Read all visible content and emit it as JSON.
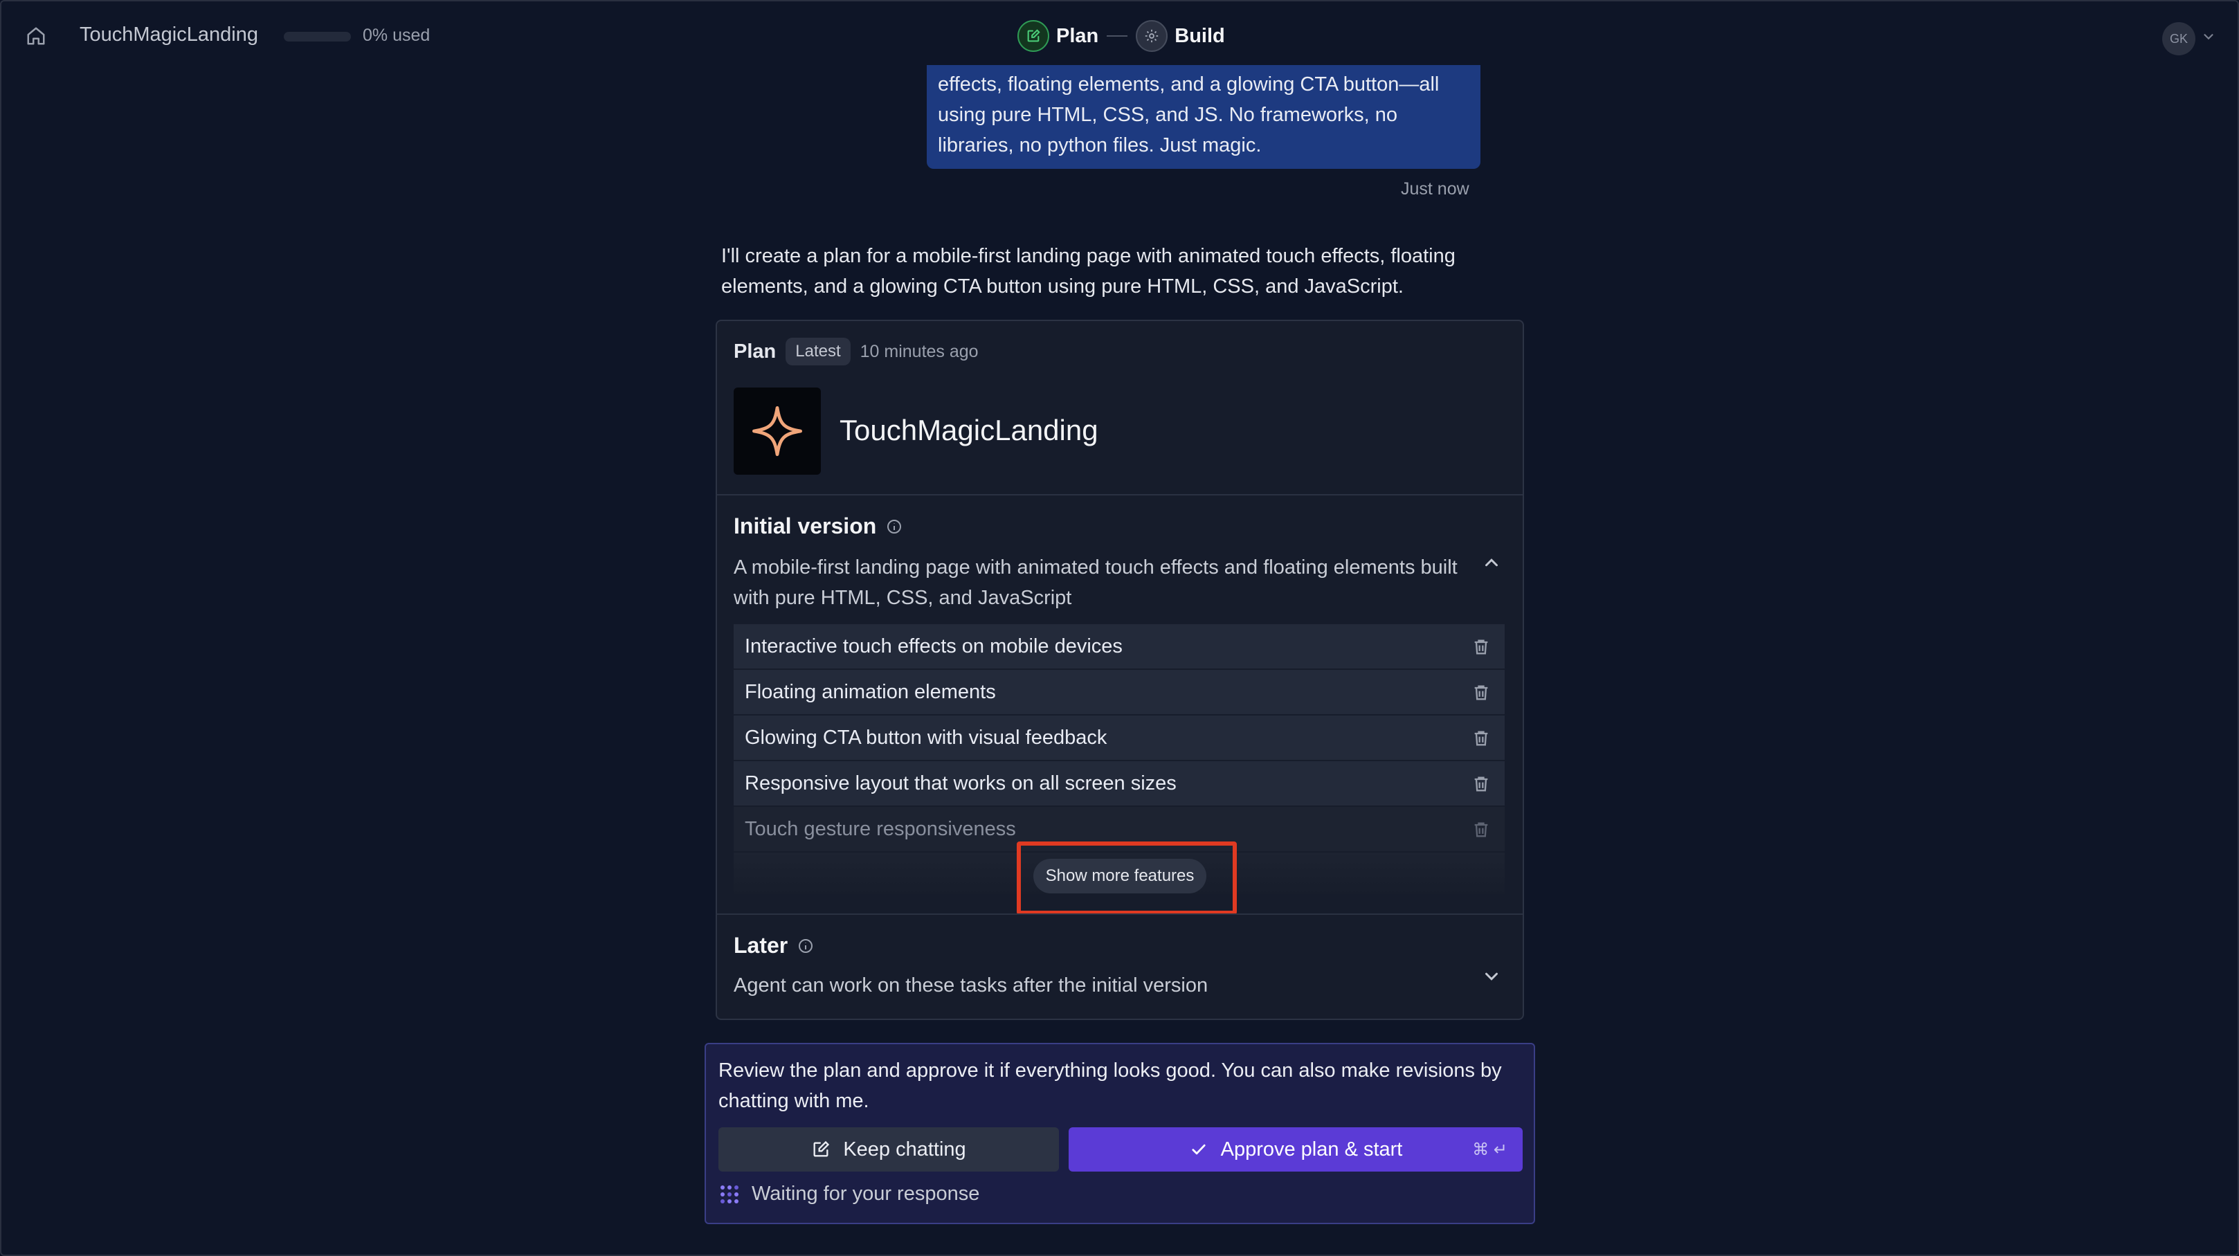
{
  "header": {
    "app_name": "TouchMagicLanding",
    "usage_text": "0% used",
    "usage_fraction": 0.0,
    "steps": [
      {
        "label": "Plan",
        "icon": "edit-icon"
      },
      {
        "label": "Build",
        "icon": "gear-icon"
      }
    ],
    "avatar_initials": "GK"
  },
  "chat": {
    "user_message": "effects, floating elements, and a glowing CTA button—all using pure HTML, CSS, and JS. No frameworks, no libraries, no python files. Just magic.",
    "timestamp": "Just now",
    "assistant_message": "I'll create a plan for a mobile-first landing page with animated touch effects, floating elements, and a glowing CTA button using pure HTML, CSS, and JavaScript."
  },
  "plan": {
    "label": "Plan",
    "badge": "Latest",
    "time": "10 minutes ago",
    "title": "TouchMagicLanding",
    "initial": {
      "title": "Initial version",
      "description": "A mobile-first landing page with animated touch effects and floating elements built with pure HTML, CSS, and JavaScript",
      "features": [
        "Interactive touch effects on mobile devices",
        "Floating animation elements",
        "Glowing CTA button with visual feedback",
        "Responsive layout that works on all screen sizes",
        "Touch gesture responsiveness"
      ],
      "show_more_label": "Show more features"
    },
    "later": {
      "title": "Later",
      "description": "Agent can work on these tasks after the initial version"
    }
  },
  "approval": {
    "text": "Review the plan and approve it if everything looks good. You can also make revisions by chatting with me.",
    "keep_label": "Keep chatting",
    "approve_label": "Approve plan & start",
    "shortcut": "⌘ ↵",
    "waiting_text": "Waiting for your response"
  },
  "colors": {
    "background": "#0e1527",
    "user_bubble": "#1d3a80",
    "approve_button": "#5b3bd6",
    "highlight": "#e03a22",
    "plan_step_accent": "#2f9b55"
  }
}
